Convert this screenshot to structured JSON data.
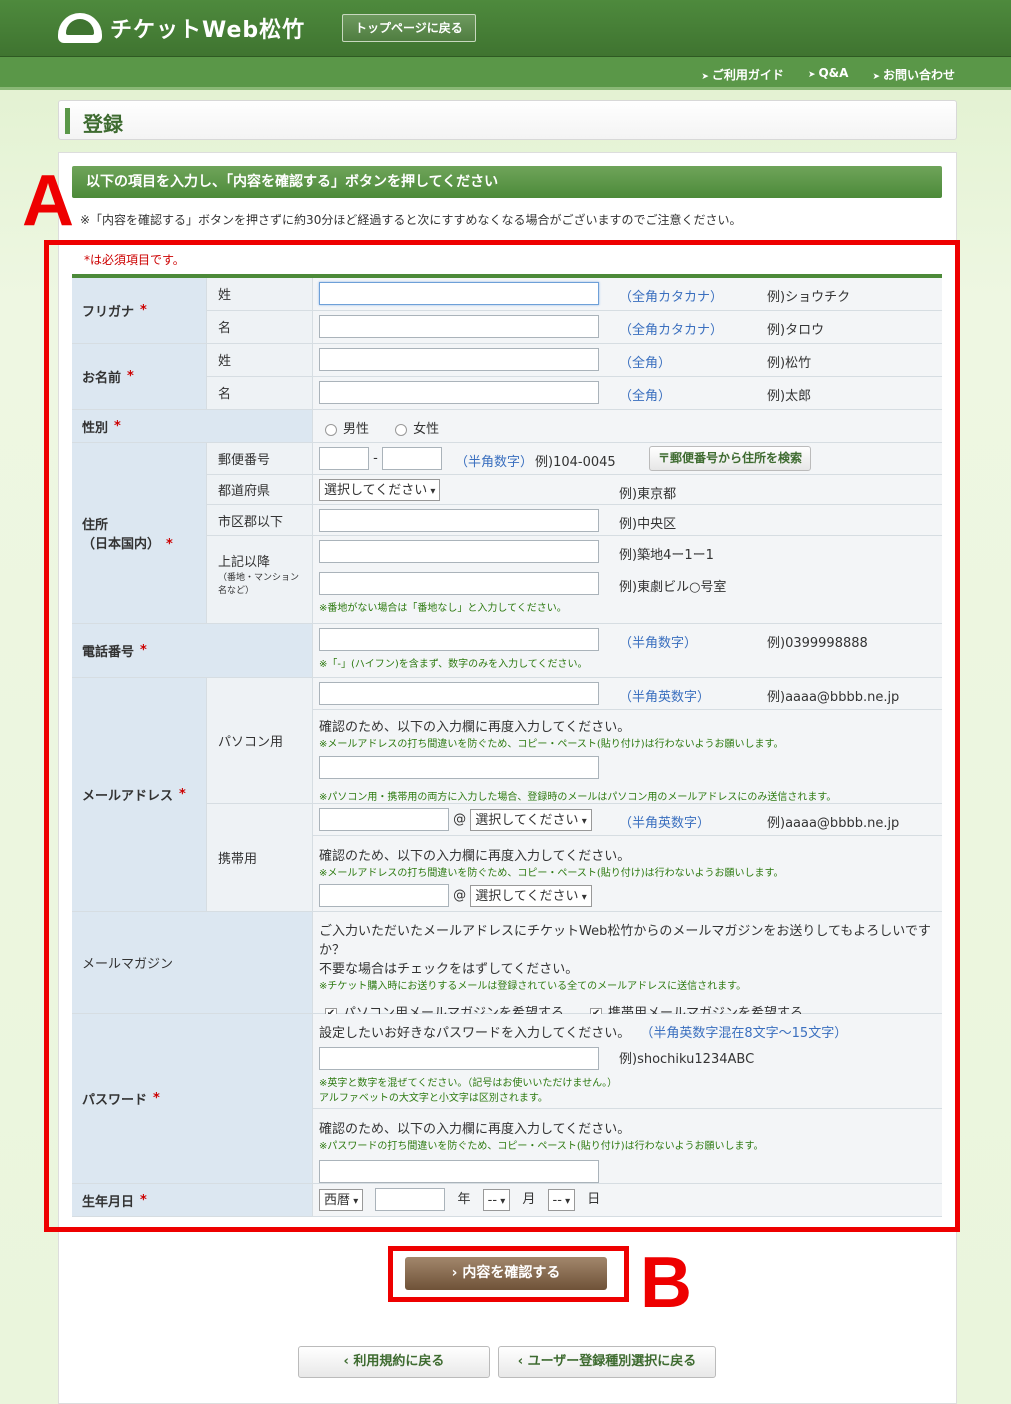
{
  "header": {
    "logo": "チケットWeb松竹",
    "top_button": "トップページに戻る"
  },
  "nav": {
    "guide": "ご利用ガイド",
    "qa": "Q&A",
    "contact": "お問い合わせ"
  },
  "page_title": "登録",
  "instruction_bar": "以下の項目を入力し、「内容を確認する」ボタンを押してください",
  "notice": "※「内容を確認する」ボタンを押さずに約30分ほど経過すると次にすすめなくなる場合がございますのでご注意ください。",
  "required_note": "*は必須項目です。",
  "req_mark": "*",
  "furigana": {
    "label": "フリガナ",
    "sei": "姓",
    "mei": "名",
    "hint": "（全角カタカナ）",
    "ex_sei": "例)ショウチク",
    "ex_mei": "例)タロウ"
  },
  "name": {
    "label": "お名前",
    "sei": "姓",
    "mei": "名",
    "hint": "（全角）",
    "ex_sei": "例)松竹",
    "ex_mei": "例)太郎"
  },
  "gender": {
    "label": "性別",
    "male": "男性",
    "female": "女性"
  },
  "address": {
    "label1": "住所",
    "label2": "（日本国内）",
    "postal": "郵便番号",
    "dash": "-",
    "postal_hint": "（半角数字）",
    "postal_ex": "例)104-0045",
    "search_btn": "〒郵便番号から住所を検索",
    "pref": "都道府県",
    "pref_select": "選択してください",
    "pref_ex": "例)東京都",
    "city": "市区郡以下",
    "city_ex": "例)中央区",
    "after": "上記以降",
    "after_sub": "（番地・マンション名など）",
    "after_ex1": "例)築地4ー1ー1",
    "after_ex2": "例)東劇ビル○号室",
    "note": "※番地がない場合は「番地なし」と入力してください。"
  },
  "phone": {
    "label": "電話番号",
    "hint": "（半角数字）",
    "ex": "例)0399998888",
    "note": "※「-」(ハイフン)を含まず、数字のみを入力してください。"
  },
  "email": {
    "label": "メールアドレス",
    "pc": "パソコン用",
    "hint": "（半角英数字）",
    "ex": "例)aaaa@bbbb.ne.jp",
    "reenter": "確認のため、以下の入力欄に再度入力してください。",
    "copy_note": "※メールアドレスの打ち間違いを防ぐため、コピー・ペースト(貼り付け)は行わないようお願いします。",
    "pc_note": "※パソコン用・携帯用の両方に入力した場合、登録時のメールはパソコン用のメールアドレスにのみ送信されます。",
    "mobile": "携帯用",
    "at": "@",
    "domain_select": "選択してください"
  },
  "magazine": {
    "label": "メールマガジン",
    "q1": "ご入力いただいたメールアドレスにチケットWeb松竹からのメールマガジンをお送りしてもよろしいですか？",
    "q2": "不要な場合はチェックをはずしてください。",
    "note": "※チケット購入時にお送りするメールは登録されている全てのメールアドレスに送信されます。",
    "pc": "パソコン用メールマガジンを希望する",
    "mobile": "携帯用メールマガジンを希望する"
  },
  "password": {
    "label": "パスワード",
    "intro": "設定したいお好きなパスワードを入力してください。",
    "hint": "（半角英数字混在8文字～15文字）",
    "ex": "例)shochiku1234ABC",
    "note1": "※英字と数字を混ぜてください。（記号はお使いいただけません。）",
    "note2": "アルファベットの大文字と小文字は区別されます。",
    "reenter": "確認のため、以下の入力欄に再度入力してください。",
    "copy_note": "※パスワードの打ち間違いを防ぐため、コピー・ペースト(貼り付け)は行わないようお願いします。"
  },
  "birth": {
    "label": "生年月日",
    "era": "西暦",
    "year": "年",
    "month_sel": "--",
    "month": "月",
    "day_sel": "--",
    "day": "日"
  },
  "buttons": {
    "confirm": "› 内容を確認する",
    "back_terms": "‹ 利用規約に戻る",
    "back_type": "‹ ユーザー登録種別選択に戻る"
  },
  "annotations": {
    "a": "A",
    "b": "B"
  }
}
